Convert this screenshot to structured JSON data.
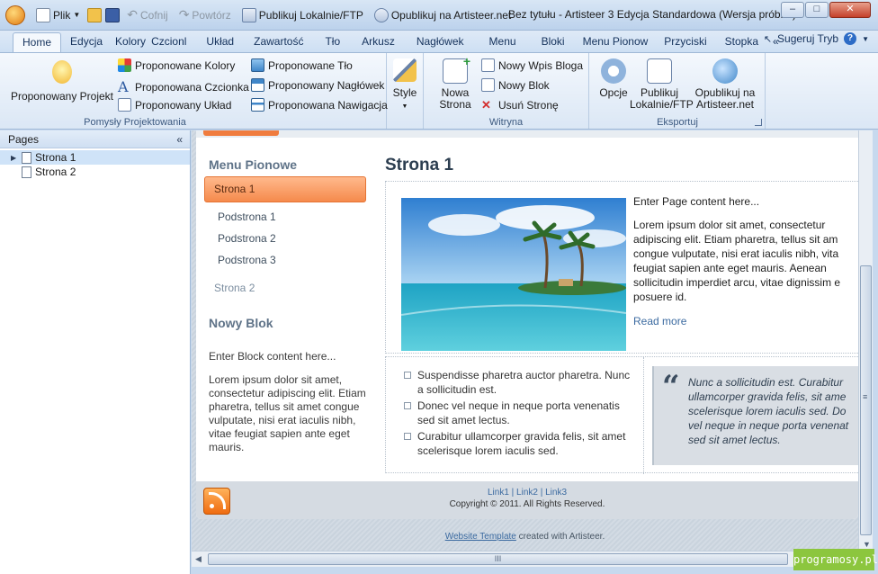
{
  "window": {
    "title": "Bez tytułu - Artisteer 3 Edycja Standardowa (Wersja próbna)",
    "minimize": "–",
    "maximize": "□",
    "close": "✕"
  },
  "quick_access": {
    "file": "Plik",
    "undo": "Cofnij",
    "redo": "Powtórz",
    "publish_local": "Publikuj Lokalnie/FTP",
    "publish_online": "Opublikuj na Artisteer.net"
  },
  "tabs": [
    "Home",
    "Edycja",
    "Kolory",
    "Czcionl",
    "Układ",
    "Zawartość",
    "Tło",
    "Arkusz",
    "Nagłówek",
    "Menu",
    "Bloki",
    "Menu Pionow",
    "Przyciski",
    "Stopka",
    "«"
  ],
  "tabs_right": {
    "suggest": "Sugeruj Tryb",
    "help": "?"
  },
  "ribbon": {
    "design_group": {
      "label": "Pomysły Projektowania",
      "suggest_project": "Proponowany Projekt",
      "colors": "Proponowane Kolory",
      "font": "Proponowana Czcionka",
      "layout": "Proponowany Układ",
      "background": "Proponowane Tło",
      "header": "Proponowany Nagłówek",
      "navigation": "Proponowana Nawigacja",
      "style": "Style"
    },
    "site_group": {
      "label": "Witryna",
      "new_page": "Nowa Strona",
      "new_post": "Nowy Wpis Bloga",
      "new_block": "Nowy Blok",
      "delete_page": "Usuń Stronę"
    },
    "export_group": {
      "label": "Eksportuj",
      "options": "Opcje",
      "publish_local_l1": "Publikuj",
      "publish_local_l2": "Lokalnie/FTP",
      "publish_net_l1": "Opublikuj na",
      "publish_net_l2": "Artisteer.net"
    }
  },
  "pages_panel": {
    "title": "Pages",
    "collapse": "«",
    "items": [
      "Strona 1",
      "Strona 2"
    ]
  },
  "preview": {
    "sidebar": {
      "menu_title": "Menu Pionowe",
      "active_item": "Strona 1",
      "subitems": [
        "Podstrona 1",
        "Podstrona 2",
        "Podstrona 3"
      ],
      "item2": "Strona 2",
      "block_title": "Nowy Blok",
      "block_intro": "Enter Block content here...",
      "block_text": "Lorem ipsum dolor sit amet, consectetur adipiscing elit. Etiam pharetra, tellus sit amet congue vulputate, nisi erat iaculis nibh, vitae feugiat sapien ante eget mauris."
    },
    "post": {
      "title": "Strona 1",
      "intro": "Enter Page content here...",
      "lines": [
        "Lorem ipsum dolor sit amet, consectetur",
        "adipiscing elit. Etiam pharetra, tellus sit am",
        "congue vulputate, nisi erat iaculis nibh, vita",
        "feugiat sapien ante eget mauris. Aenean",
        "sollicitudin imperdiet arcu, vitae dignissim e",
        "posuere id."
      ],
      "read_more": "Read more"
    },
    "bullets": [
      "Suspendisse pharetra auctor pharetra. Nunc a sollicitudin est.",
      "Donec vel neque in neque porta venenatis sed sit amet lectus.",
      "Curabitur ullamcorper gravida felis, sit amet scelerisque lorem iaculis sed."
    ],
    "quote_lines": [
      "Nunc a sollicitudin est. Curabitur",
      "ullamcorper gravida felis, sit ame",
      "scelerisque lorem iaculis sed. Do",
      "vel neque in neque porta venenat",
      "sed sit amet lectus."
    ],
    "footer": {
      "links": "Link1 | Link2 | Link3",
      "copyright": "Copyright © 2011. All Rights Reserved."
    },
    "credits": {
      "link": "Website Template",
      "rest": " created with Artisteer."
    }
  },
  "scroll": {
    "h_grip": "III",
    "v_grip": "≡"
  },
  "watermark": "programosy.pl",
  "colors": {
    "accent": "#f58a4c",
    "ribbon": "#dbe7f5",
    "link": "#3b6aa0"
  }
}
